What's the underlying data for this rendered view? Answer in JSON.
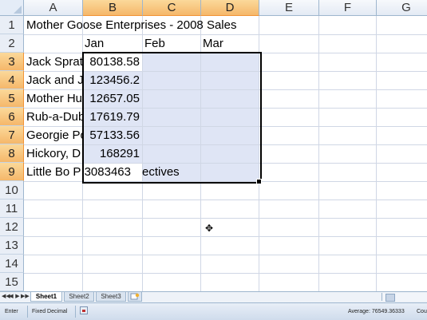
{
  "sheet": {
    "columns": [
      "A",
      "B",
      "C",
      "D",
      "E",
      "F",
      "G"
    ],
    "rows": [
      "1",
      "2",
      "3",
      "4",
      "5",
      "6",
      "7",
      "8",
      "9",
      "10",
      "11",
      "12",
      "13",
      "14",
      "15"
    ],
    "cells": {
      "A1": "Mother Goose Enterprises - 2008 Sales",
      "B2": "Jan",
      "C2": "Feb",
      "D2": "Mar",
      "A3": "Jack Sprat",
      "A4": "Jack and Ji",
      "A5": "Mother Hu",
      "A6": "Rub-a-Dub",
      "A7": "Georgie Po",
      "A8": "Hickory, D",
      "A9": "Little Bo P",
      "C9": "ectives",
      "B3": "80138.58",
      "B4": "123456.2",
      "B5": "12657.05",
      "B6": "17619.79",
      "B7": "57133.56",
      "B8": "168291",
      "B9": "3083463"
    }
  },
  "tabs": [
    "Sheet1",
    "Sheet2",
    "Sheet3"
  ],
  "tab_nav": [
    "◀◀",
    "◀",
    "▶",
    "▶▶"
  ],
  "status": {
    "mode": "Enter",
    "fixed_decimal": "Fixed Decimal",
    "average": "Average: 76549.36333",
    "count": "Cou"
  },
  "colors": {
    "selected_header": "#f5b76a",
    "selection_fill": "#dfe5f5",
    "grid_line": "#d0d7e5"
  }
}
